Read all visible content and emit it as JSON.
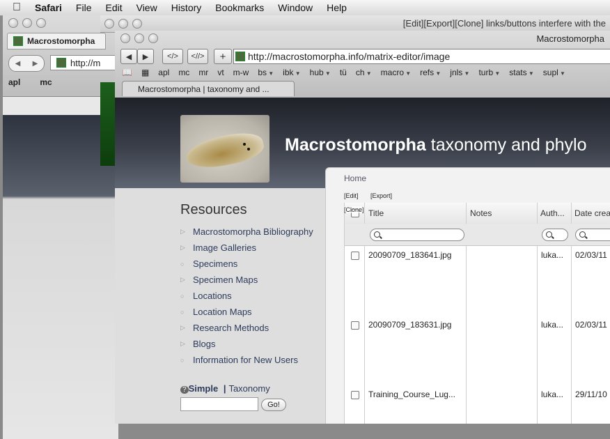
{
  "menubar": {
    "app": "Safari",
    "items": [
      "File",
      "Edit",
      "View",
      "History",
      "Bookmarks",
      "Window",
      "Help"
    ]
  },
  "back_window": {
    "tab_title": "Macrostomorpha",
    "url": "http://m",
    "bookmarks": [
      "apl",
      "mc"
    ]
  },
  "middle_window": {
    "title": "[Edit][Export][Clone] links/buttons interfere with the"
  },
  "front_window": {
    "title": "Macrostomorpha",
    "url": "http://macrostomorpha.info/matrix-editor/image",
    "toolbar": {
      "back": "◀",
      "forward": "▶",
      "view_source": "</>",
      "view_source_2": "<//>",
      "new_tab": "+"
    },
    "bookmarks": [
      {
        "label": "apl",
        "menu": false
      },
      {
        "label": "mc",
        "menu": false
      },
      {
        "label": "mr",
        "menu": false
      },
      {
        "label": "vt",
        "menu": false
      },
      {
        "label": "m-w",
        "menu": false
      },
      {
        "label": "bs",
        "menu": true
      },
      {
        "label": "ibk",
        "menu": true
      },
      {
        "label": "hub",
        "menu": true
      },
      {
        "label": "tü",
        "menu": false
      },
      {
        "label": "ch",
        "menu": true
      },
      {
        "label": "macro",
        "menu": true
      },
      {
        "label": "refs",
        "menu": true
      },
      {
        "label": "jnls",
        "menu": true
      },
      {
        "label": "turb",
        "menu": true
      },
      {
        "label": "stats",
        "menu": true
      },
      {
        "label": "supl",
        "menu": true
      }
    ],
    "tab_title": "Macrostomorpha | taxonomy and ..."
  },
  "site": {
    "title_bold": "Macrostomorpha",
    "title_rest": " taxonomy and phylo",
    "resources_heading": "Resources",
    "resources": [
      {
        "label": "Macrostomorpha Bibliography",
        "marker": "▷"
      },
      {
        "label": "Image Galleries",
        "marker": "▷"
      },
      {
        "label": "Specimens",
        "marker": "○"
      },
      {
        "label": "Specimen Maps",
        "marker": "▷"
      },
      {
        "label": "Locations",
        "marker": "○"
      },
      {
        "label": "Location Maps",
        "marker": "○"
      },
      {
        "label": "Research Methods",
        "marker": "▷"
      },
      {
        "label": "Blogs",
        "marker": "▷"
      },
      {
        "label": "Information for New Users",
        "marker": "○"
      }
    ],
    "search": {
      "help_icon": "?",
      "simple": "Simple",
      "sep": "|",
      "taxonomy": "Taxonomy",
      "go": "Go!",
      "value": ""
    },
    "breadcrumb": "Home",
    "actions": {
      "edit": "[Edit]",
      "export": "[Export]",
      "clone": "[Clone]"
    },
    "columns": [
      "Title",
      "Notes",
      "Auth...",
      "Date crea"
    ],
    "rows": [
      {
        "title": "20090709_183641.jpg",
        "notes": "",
        "author": "luka...",
        "date": "02/03/11"
      },
      {
        "title": "20090709_183631.jpg",
        "notes": "",
        "author": "luka...",
        "date": "02/03/11"
      },
      {
        "title": "Training_Course_Lug...",
        "notes": "",
        "author": "luka...",
        "date": "29/11/10"
      }
    ]
  }
}
